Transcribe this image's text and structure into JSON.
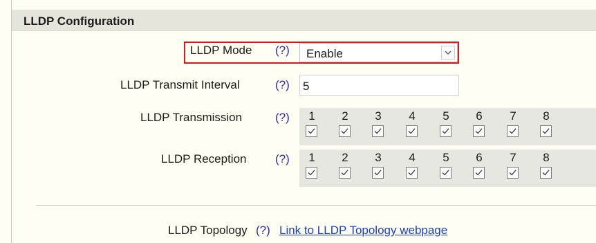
{
  "header": {
    "title": "LLDP Configuration"
  },
  "help_text": "(?)",
  "mode": {
    "label": "LLDP Mode",
    "selected": "Enable"
  },
  "transmit_interval": {
    "label": "LLDP Transmit Interval",
    "value": "5"
  },
  "transmission": {
    "label": "LLDP Transmission",
    "ports": [
      "1",
      "2",
      "3",
      "4",
      "5",
      "6",
      "7",
      "8"
    ],
    "checked": [
      true,
      true,
      true,
      true,
      true,
      true,
      true,
      true
    ]
  },
  "reception": {
    "label": "LLDP Reception",
    "ports": [
      "1",
      "2",
      "3",
      "4",
      "5",
      "6",
      "7",
      "8"
    ],
    "checked": [
      true,
      true,
      true,
      true,
      true,
      true,
      true,
      true
    ]
  },
  "topology": {
    "label": "LLDP Topology",
    "link_text": "Link to LLDP Topology webpage"
  },
  "colors": {
    "highlight_border": "#d41a1a",
    "help_link": "#2a2ab8",
    "hyperlink": "#1b3ec9",
    "header_bg": "#e5e5dc"
  }
}
